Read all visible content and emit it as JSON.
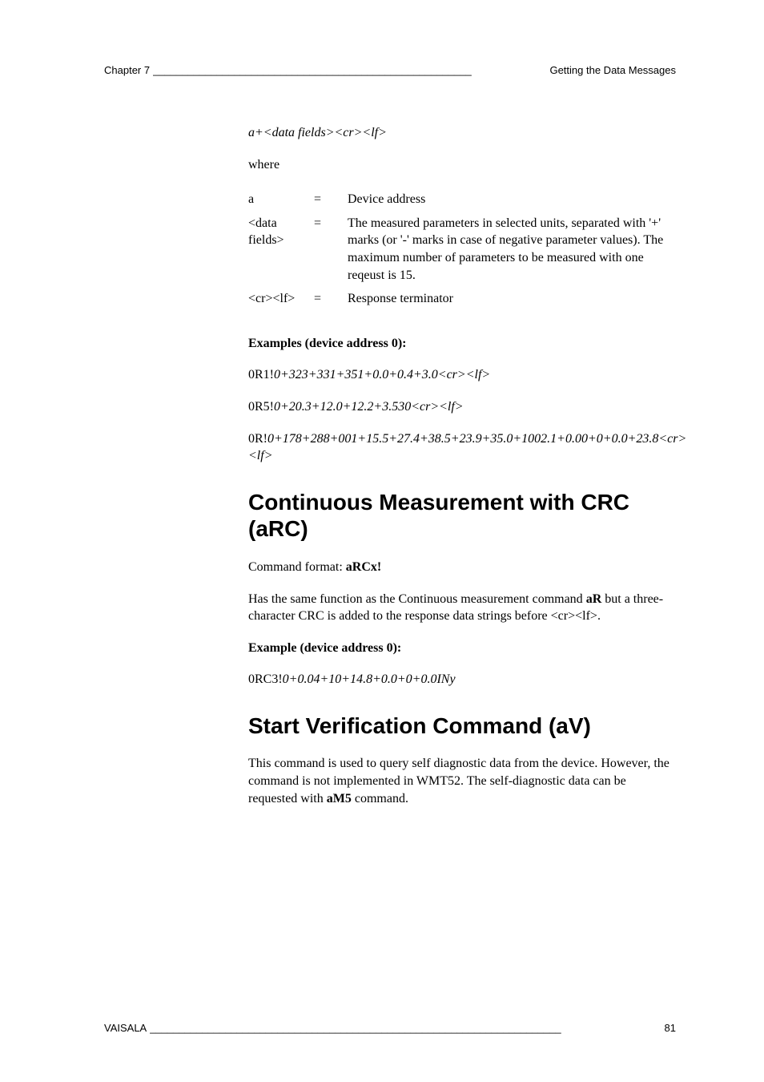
{
  "header": {
    "left": "Chapter 7",
    "right": "Getting the Data Messages"
  },
  "response_format": "a+<data fields><cr><lf>",
  "where_label": "where",
  "defs": {
    "row1": {
      "term": "a",
      "eq": "=",
      "desc": "Device address"
    },
    "row2": {
      "term": "<data fields>",
      "eq": "=",
      "desc": "The measured parameters in selected units, separated with '+' marks (or '-' marks in case of negative parameter values). The maximum number of parameters to be measured with one reqeust is 15."
    },
    "row3": {
      "term": "<cr><lf>",
      "eq": "=",
      "desc": "Response terminator"
    }
  },
  "examples_heading": "Examples (device address 0):",
  "example1": {
    "prefix": "0R1!",
    "body": "0+323+331+351+0.0+0.4+3.0<cr><lf>"
  },
  "example2": {
    "prefix": "0R5!",
    "body": "0+20.3+12.0+12.2+3.530<cr><lf>"
  },
  "example3": {
    "prefix": "0R!",
    "body": "0+178+288+001+15.5+27.4+38.5+23.9+35.0+1002.1+0.00+0+0.0+23.8<cr><lf>"
  },
  "section1": {
    "title": "Continuous Measurement with CRC (aRC)",
    "cmd_label": "Command format: ",
    "cmd": "aRCx!",
    "desc_pre": "Has the same function as the Continuous measurement command ",
    "desc_bold": "aR",
    "desc_post": " but a three-character CRC is added to the response data strings before <cr><lf>.",
    "ex_heading": "Example (device address 0):",
    "ex": {
      "prefix": "0RC3!",
      "body": "0+0.04+10+14.8+0.0+0+0.0INy"
    }
  },
  "section2": {
    "title": "Start Verification Command (aV)",
    "desc_pre": "This command is used to query self diagnostic data from the device. However, the command is not implemented in WMT52. The self-diagnostic data can be requested with ",
    "desc_bold": "aM5",
    "desc_post": " command."
  },
  "footer": {
    "left": "VAISALA",
    "right": "81"
  }
}
